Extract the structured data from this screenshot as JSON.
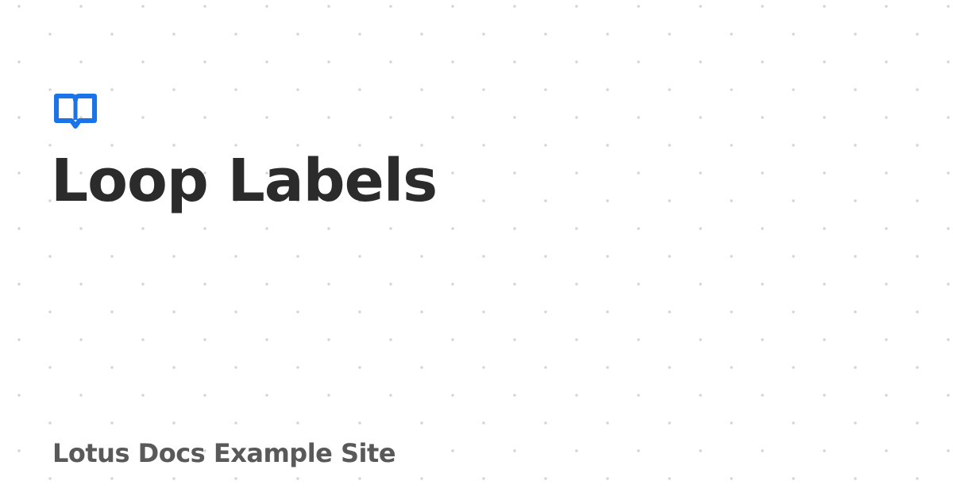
{
  "logo": {
    "icon": "open-book-icon",
    "color": "#1a73e8"
  },
  "title": "Loop Labels",
  "site_name": "Lotus Docs Example Site"
}
